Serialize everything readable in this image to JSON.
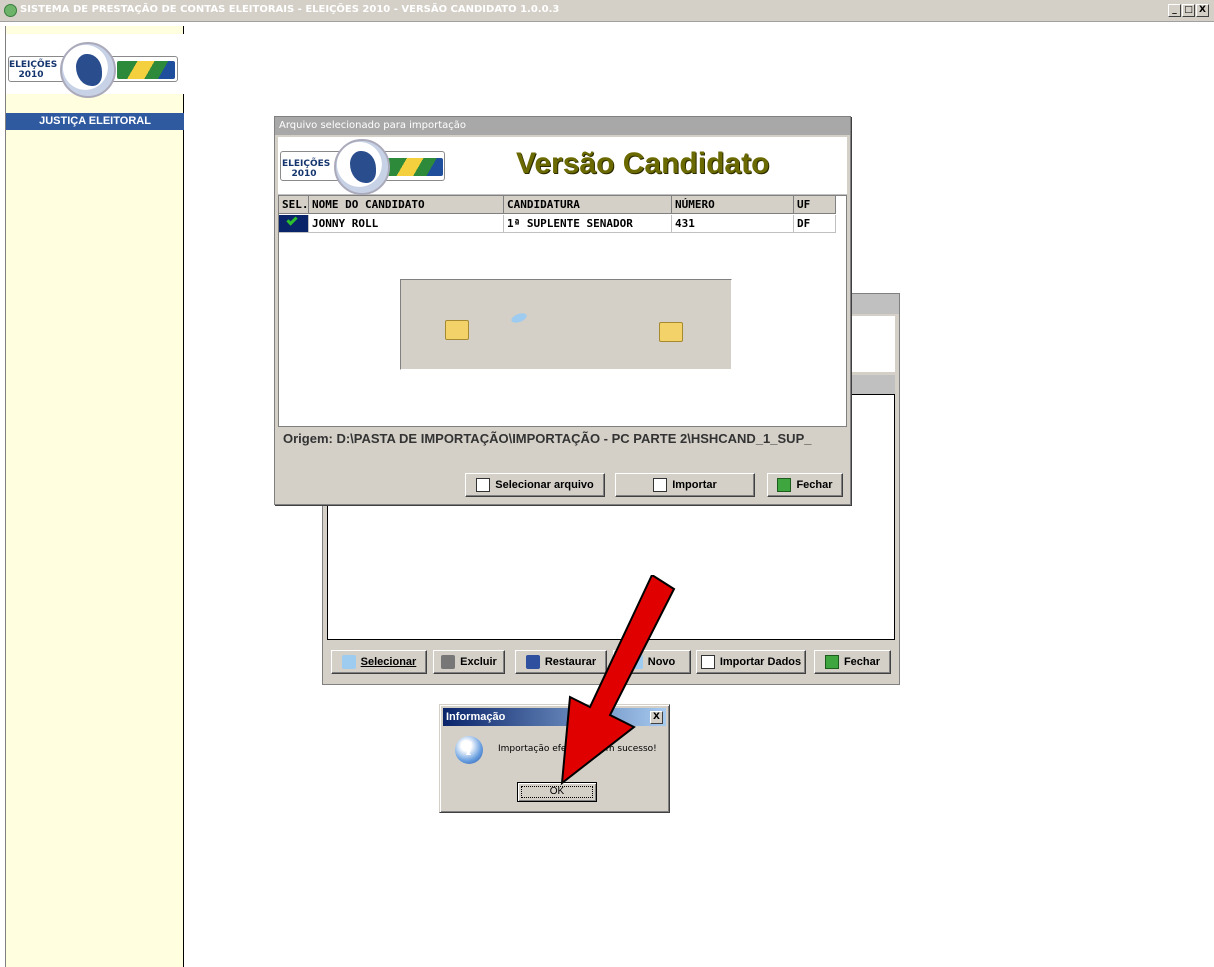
{
  "main_window": {
    "title": "SISTEMA DE PRESTAÇÃO DE CONTAS ELEITORAIS - ELEIÇÕES 2010 -  VERSÃO CANDIDATO 1.0.0.3",
    "minimize": "_",
    "maximize": "□",
    "close": "X"
  },
  "sidebar": {
    "logo_text_line1": "ELEIÇÕES",
    "logo_text_line2": "2010",
    "nav_item": "JUSTIÇA ELEITORAL"
  },
  "back_window": {
    "buttons": [
      "Selecionar",
      "Excluir",
      "Restaurar",
      "Novo",
      "Importar Dados",
      "Fechar"
    ]
  },
  "import_window": {
    "title": "Arquivo selecionado para importação",
    "logo_text_line1": "ELEIÇÕES",
    "logo_text_line2": "2010",
    "heading": "Versão Candidato",
    "table": {
      "columns": [
        "SEL.",
        "NOME DO CANDIDATO",
        "CANDIDATURA",
        "NÚMERO",
        "UF"
      ],
      "rows": [
        {
          "nome": "JONNY ROLL",
          "candidatura": "1ª SUPLENTE SENADOR",
          "numero": "431",
          "uf": "DF"
        }
      ]
    },
    "origin": "Origem: D:\\PASTA DE IMPORTAÇÃO\\IMPORTAÇÃO - PC PARTE 2\\HSHCAND_1_SUP_",
    "buttons": {
      "select_file": "Selecionar arquivo",
      "import": "Importar",
      "close": "Fechar"
    }
  },
  "info_dialog": {
    "title": "Informação",
    "close": "X",
    "message": "Importação efetuada com sucesso!",
    "ok": "OK"
  },
  "colors": {
    "sidebar_bg": "#ffffe0",
    "nav_bg": "#2f5aa0",
    "heading": "#6b6a00",
    "dialog_title": "#0a246a",
    "arrow": "#e00000"
  }
}
